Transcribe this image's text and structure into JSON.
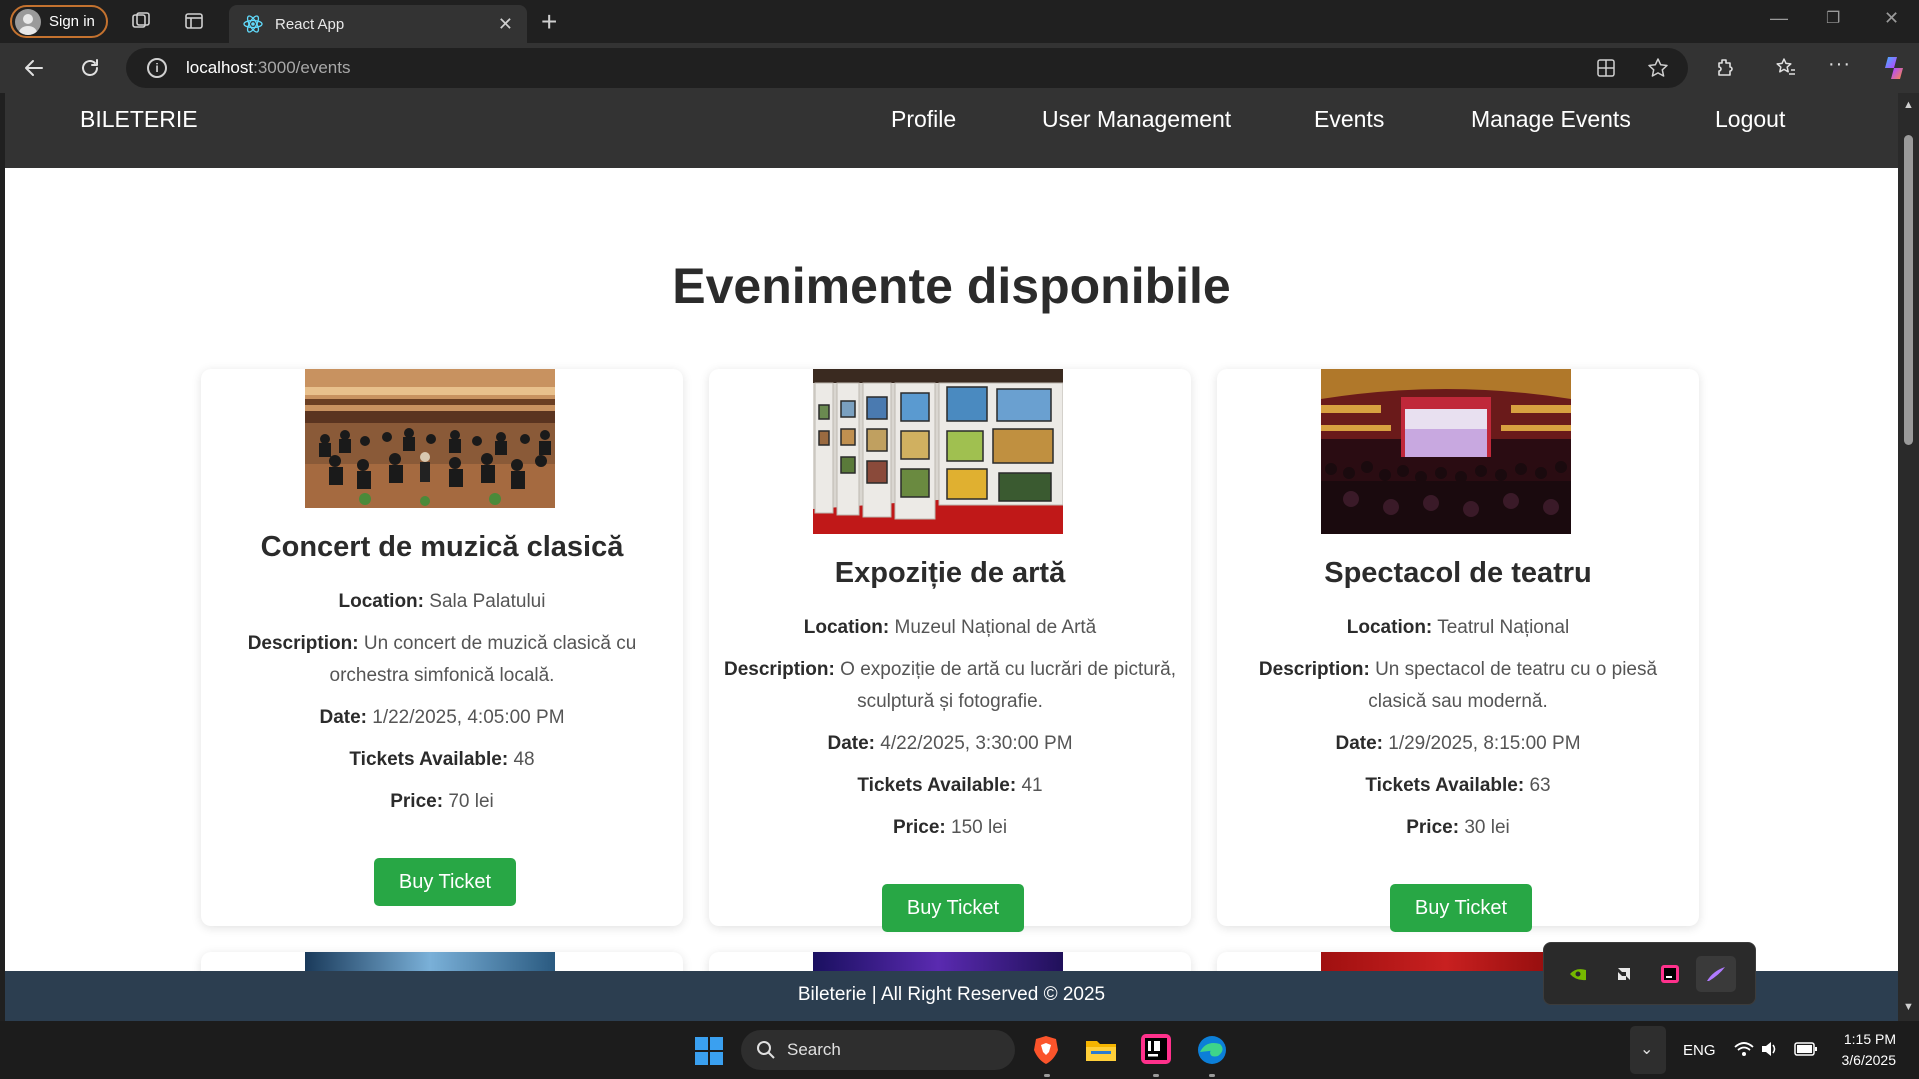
{
  "browser": {
    "signin_label": "Sign in",
    "tab_title": "React App",
    "url_host": "localhost",
    "url_path": ":3000/events"
  },
  "site": {
    "brand": "BILETERIE",
    "nav": [
      "Profile",
      "User Management",
      "Events",
      "Manage Events",
      "Logout"
    ],
    "page_title": "Evenimente disponibile",
    "footer": "Bileterie | All Right Reserved © 2025"
  },
  "labels": {
    "location": "Location:",
    "description": "Description:",
    "date": "Date:",
    "tickets": "Tickets Available:",
    "price": "Price:",
    "buy": "Buy Ticket"
  },
  "events": [
    {
      "title": "Concert de muzică clasică",
      "location": "Sala Palatului",
      "description": "Un concert de muzică clasică cu orchestra simfonică locală.",
      "date": "1/22/2025, 4:05:00 PM",
      "tickets": "48",
      "price": "70 lei"
    },
    {
      "title": "Expoziție de artă",
      "location": "Muzeul Național de Artă",
      "description": "O expoziție de artă cu lucrări de pictură, sculptură și fotografie.",
      "date": "4/22/2025, 3:30:00 PM",
      "tickets": "41",
      "price": "150 lei"
    },
    {
      "title": "Spectacol de teatru",
      "location": "Teatrul Național",
      "description": "Un spectacol de teatru cu o piesă clasică sau modernă.",
      "date": "1/29/2025, 8:15:00 PM",
      "tickets": "63",
      "price": "30 lei"
    }
  ],
  "taskbar": {
    "search_label": "Search",
    "lang": "ENG",
    "time": "1:15 PM",
    "date": "3/6/2025"
  }
}
